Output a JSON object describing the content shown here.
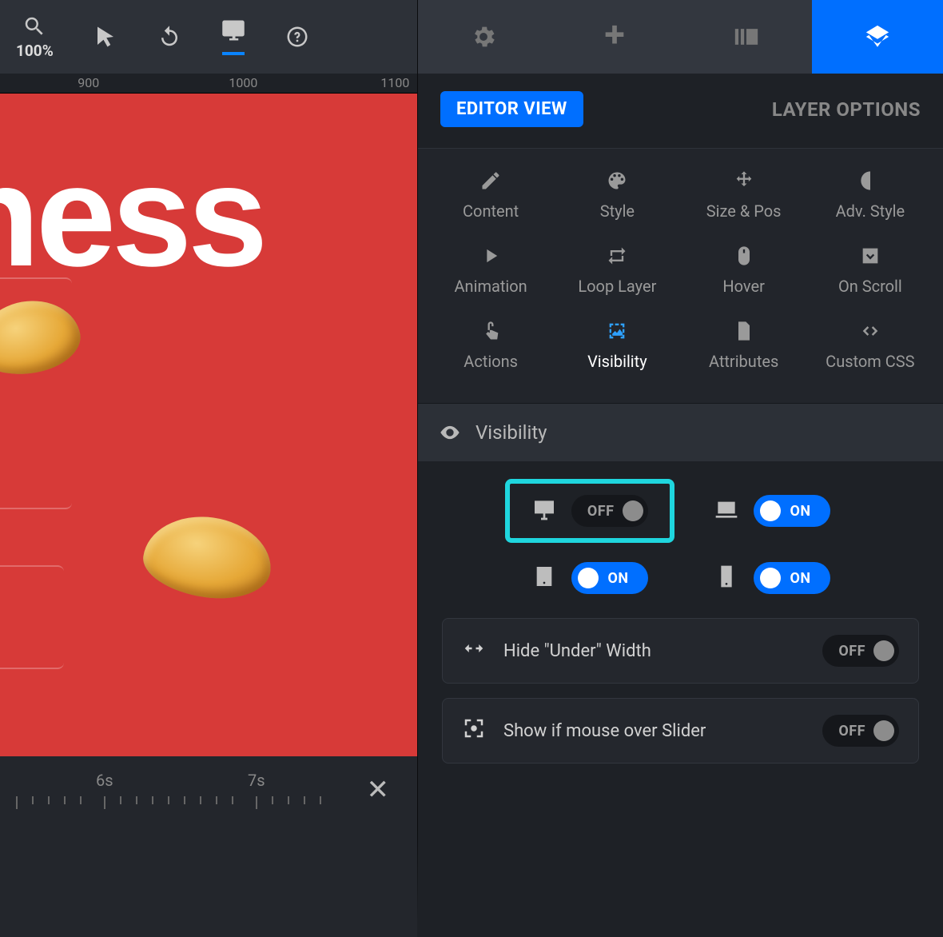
{
  "toolbar": {
    "zoom": "100%"
  },
  "ruler": {
    "n1": "900",
    "n2": "1000",
    "n3": "1100"
  },
  "canvas": {
    "headline_fragment": "ness"
  },
  "timeline": {
    "t1": "6s",
    "t2": "7s"
  },
  "panel_header": {
    "editor_view": "EDITOR VIEW",
    "layer_options": "LAYER OPTIONS"
  },
  "tabs": {
    "content": "Content",
    "style": "Style",
    "sizepos": "Size & Pos",
    "advstyle": "Adv. Style",
    "animation": "Animation",
    "loop": "Loop Layer",
    "hover": "Hover",
    "onscroll": "On Scroll",
    "actions": "Actions",
    "visibility": "Visibility",
    "attributes": "Attributes",
    "customcss": "Custom CSS"
  },
  "section": {
    "visibility_title": "Visibility"
  },
  "toggles": {
    "on": "ON",
    "off": "OFF"
  },
  "options": {
    "hide_under": "Hide \"Under\" Width",
    "show_mouse_over": "Show if mouse over Slider"
  }
}
